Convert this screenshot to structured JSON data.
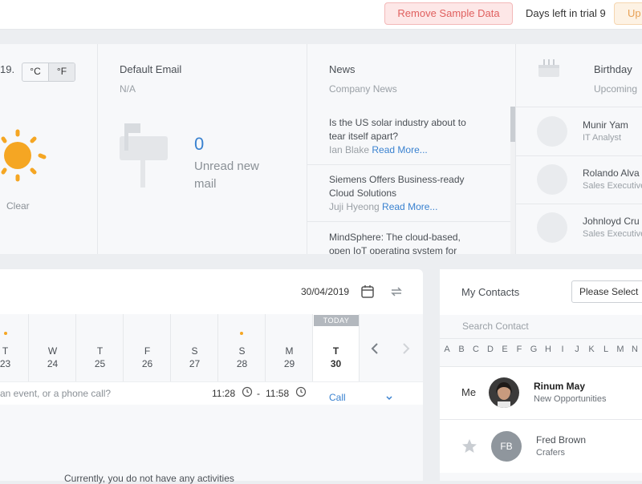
{
  "topbar": {
    "remove_sample_label": "Remove Sample Data",
    "trial_text": "Days left in trial 9",
    "upgrade_label": "Up"
  },
  "weather": {
    "date_fragment": "19.",
    "unit_c": "°C",
    "unit_f": "°F",
    "selected_unit": "°F",
    "condition": "Clear",
    "icon": "sun-icon"
  },
  "email": {
    "title": "Default Email",
    "account": "N/A",
    "unread_count": "0",
    "unread_label_1": "Unread new",
    "unread_label_2": "mail",
    "icon": "mailbox-icon"
  },
  "news": {
    "title": "News",
    "subtitle": "Company News",
    "read_more": "Read More...",
    "items": [
      {
        "line1": "Is the US solar industry about to",
        "line2": "tear itself apart?",
        "author": "Ian Blake"
      },
      {
        "line1": "Siemens Offers Business-ready",
        "line2": "Cloud Solutions",
        "author": "Juji Hyeong"
      },
      {
        "line1": "MindSphere: The cloud-based,",
        "line2": "open IoT operating system for",
        "author": ""
      }
    ]
  },
  "birthday": {
    "title": "Birthday",
    "subtitle": "Upcoming",
    "icon": "cake-icon",
    "people": [
      {
        "name": "Munir Yam",
        "role": "IT Analyst"
      },
      {
        "name": "Rolando Alva",
        "role": "Sales Executive"
      },
      {
        "name": "Johnloyd Cru",
        "role": "Sales Executive"
      }
    ]
  },
  "calendar": {
    "date": "30/04/2019",
    "today_label": "TODAY",
    "days": [
      {
        "dn": "T",
        "dd": "23",
        "dot": true
      },
      {
        "dn": "W",
        "dd": "24",
        "dot": false
      },
      {
        "dn": "T",
        "dd": "25",
        "dot": false
      },
      {
        "dn": "F",
        "dd": "26",
        "dot": false
      },
      {
        "dn": "S",
        "dd": "27",
        "dot": false
      },
      {
        "dn": "S",
        "dd": "28",
        "dot": true
      },
      {
        "dn": "M",
        "dd": "29",
        "dot": false
      },
      {
        "dn": "T",
        "dd": "30",
        "dot": false
      }
    ],
    "activity_placeholder": "an event, or a phone call?",
    "time_start": "11:28",
    "time_sep": "-",
    "time_end": "11:58",
    "activity_type": "Call",
    "empty_text": "Currently, you do not have any activities"
  },
  "contacts": {
    "title": "My Contacts",
    "select_value": "Please Select",
    "search_placeholder": "Search Contact",
    "letters": [
      "A",
      "B",
      "C",
      "D",
      "E",
      "F",
      "G",
      "H",
      "I",
      "J",
      "K",
      "L",
      "M",
      "N"
    ],
    "me_label": "Me",
    "people": [
      {
        "name": "Rinum May",
        "sub": "New Opportunities"
      },
      {
        "initials": "FB",
        "name": "Fred Brown",
        "sub": "Crafers"
      }
    ]
  },
  "colors": {
    "accent": "#3a82d0",
    "remove_btn": "#e0605f",
    "upgrade_btn": "#e8a155",
    "sun": "#f5a623",
    "dot": "#f5a623"
  }
}
